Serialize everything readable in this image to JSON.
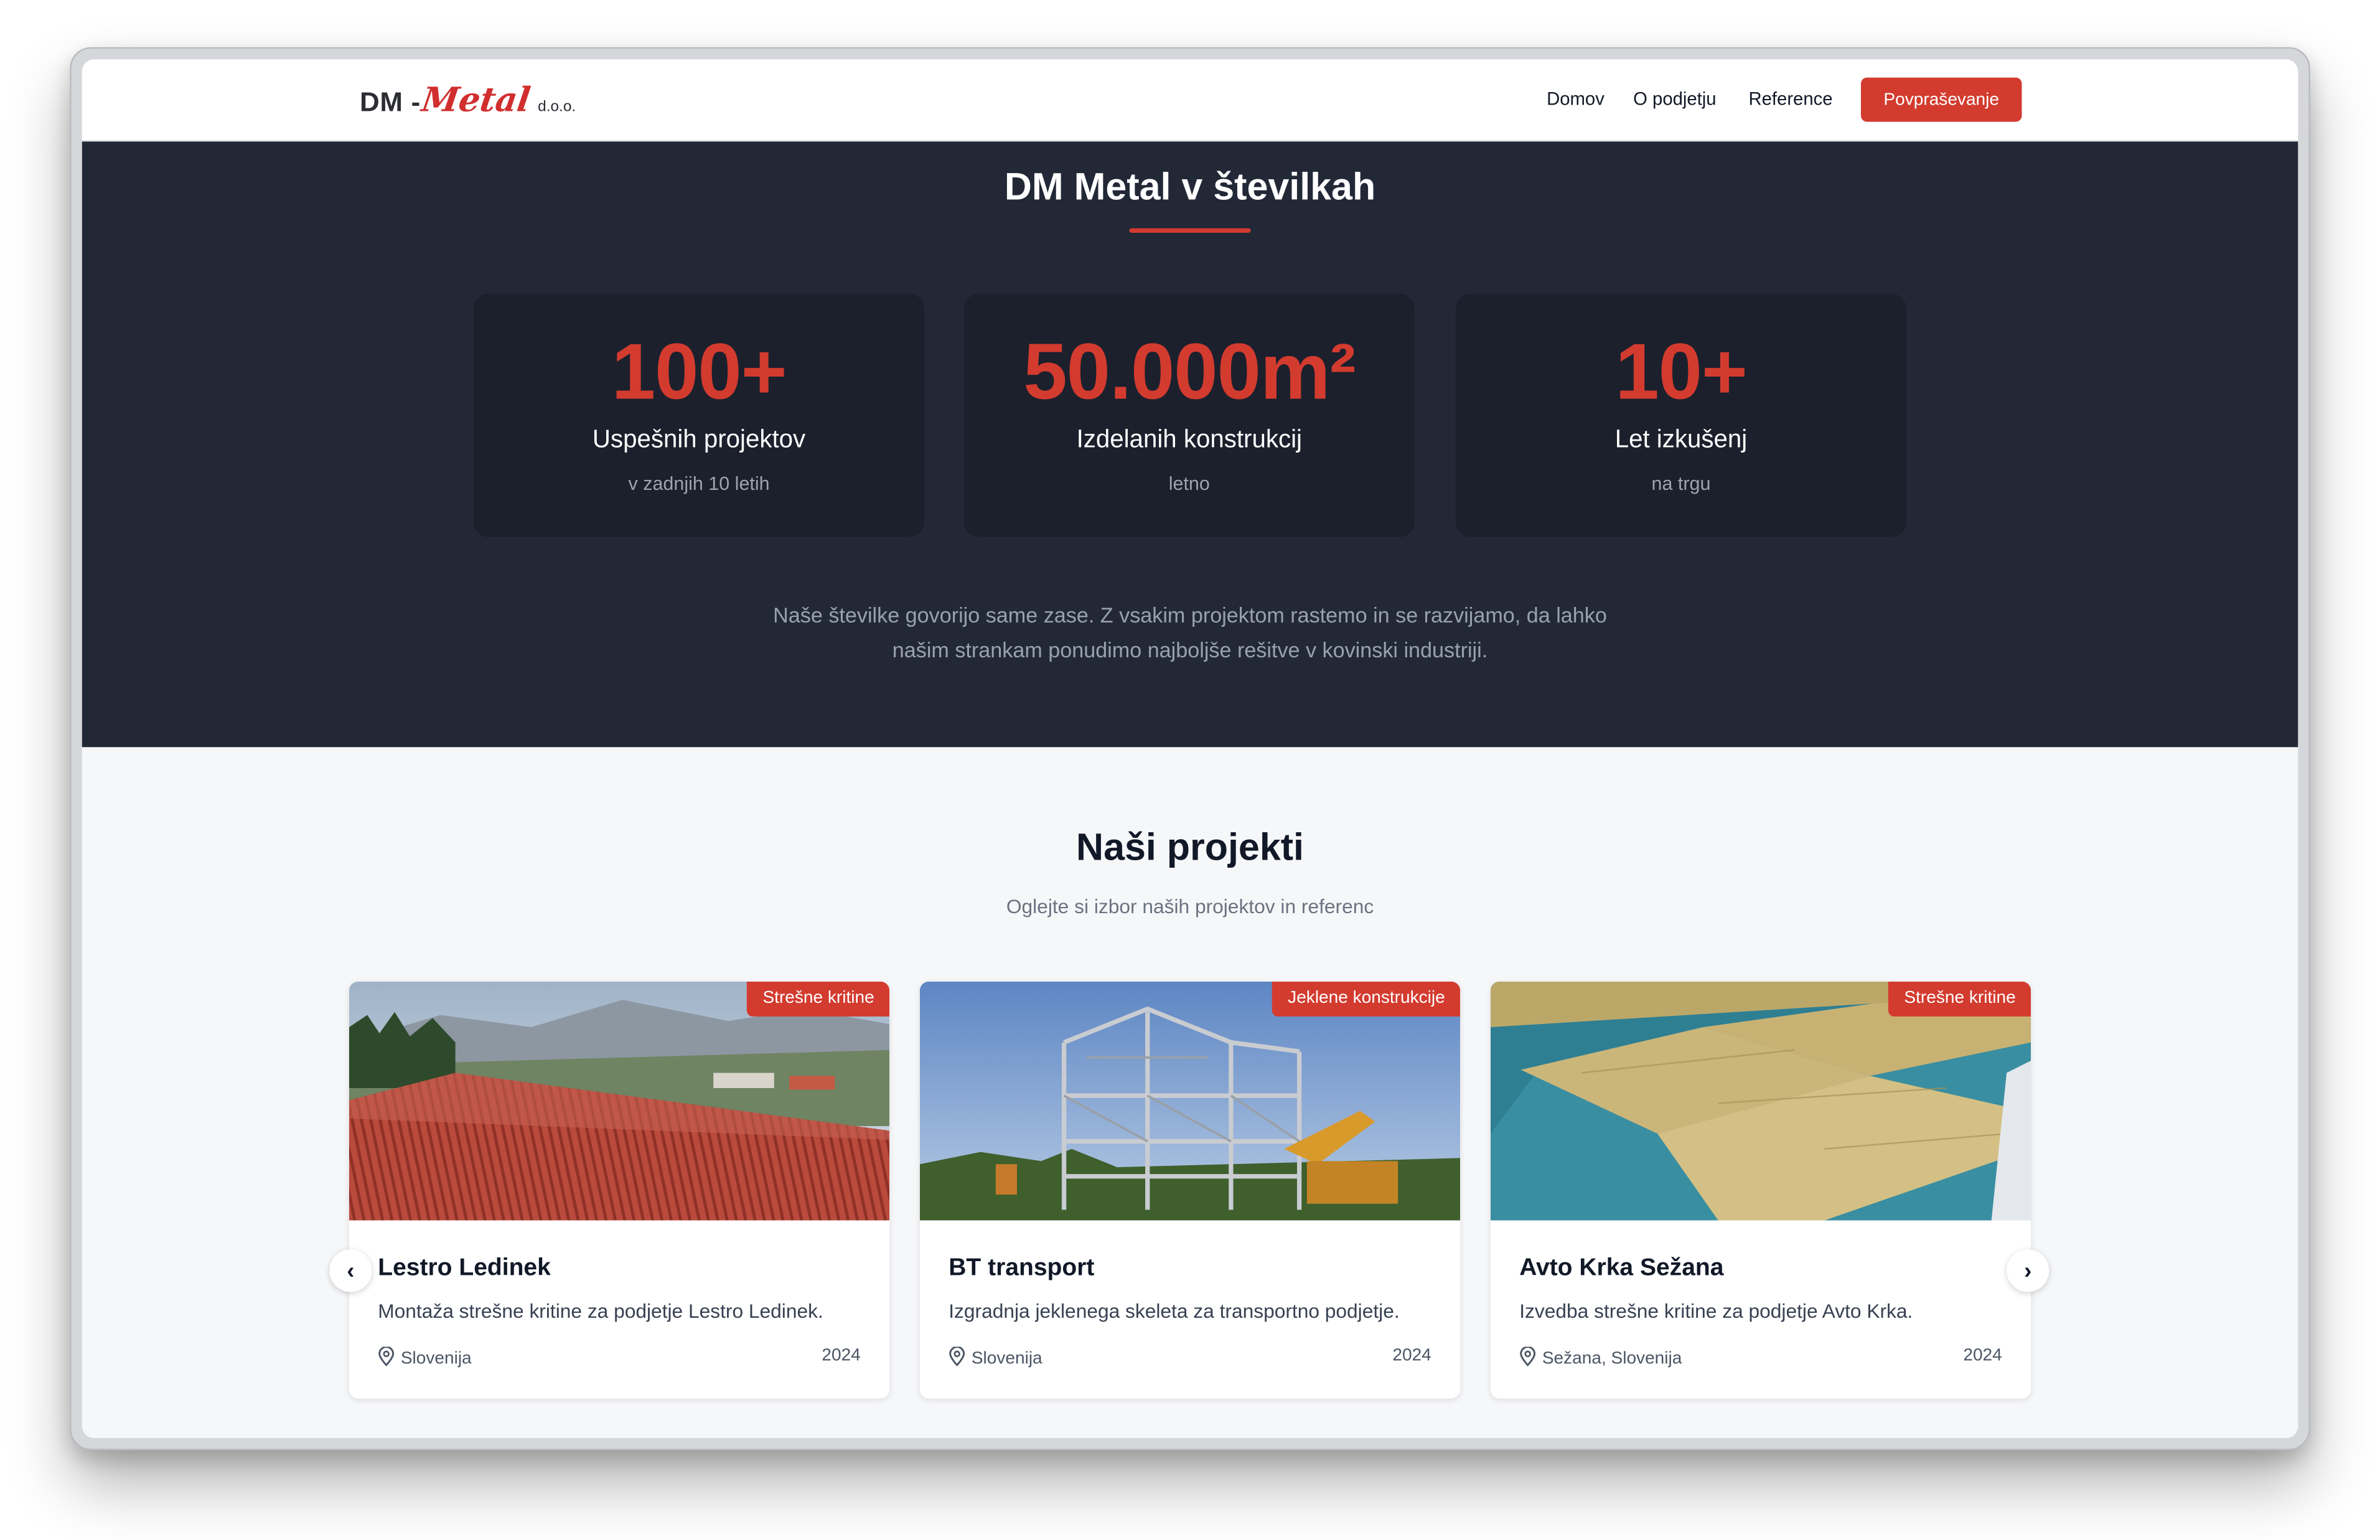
{
  "nav": {
    "logo": {
      "dm": "DM -",
      "metal": "Metal",
      "doo": "d.o.o."
    },
    "links": [
      "Domov",
      "O podjetju",
      "Reference"
    ],
    "cta": "Povpraševanje"
  },
  "stats": {
    "title": "DM Metal v številkah",
    "items": [
      {
        "value": "100+",
        "label": "Uspešnih projektov",
        "sub": "v zadnjih 10 letih"
      },
      {
        "value": "50.000m²",
        "label": "Izdelanih konstrukcij",
        "sub": "letno"
      },
      {
        "value": "10+",
        "label": "Let izkušenj",
        "sub": "na trgu"
      }
    ],
    "text": "Naše številke govorijo same zase. Z vsakim projektom rastemo in se razvijamo, da lahko našim strankam ponudimo najboljše rešitve v kovinski industriji."
  },
  "projects": {
    "title": "Naši projekti",
    "subtitle": "Oglejte si izbor naših projektov in referenc",
    "cards": [
      {
        "badge": "Strešne kritine",
        "title": "Lestro Ledinek",
        "desc": "Montaža strešne kritine za podjetje Lestro Ledinek.",
        "location": "Slovenija",
        "year": "2024",
        "image": "red-metal-roof-photo"
      },
      {
        "badge": "Jeklene konstrukcije",
        "title": "BT transport",
        "desc": "Izgradnja jeklenega skeleta za transportno podjetje.",
        "location": "Slovenija",
        "year": "2024",
        "image": "steel-skeleton-photo"
      },
      {
        "badge": "Strešne kritine",
        "title": "Avto Krka Sežana",
        "desc": "Izvedba strešne kritine za podjetje Avto Krka.",
        "location": "Sežana, Slovenija",
        "year": "2024",
        "image": "roof-insulation-photo"
      }
    ],
    "prev_arrow": "‹",
    "next_arrow": "›"
  },
  "colors": {
    "accent": "#d33b2f",
    "dark_bg": "#232837",
    "card_bg": "#1c202c"
  }
}
